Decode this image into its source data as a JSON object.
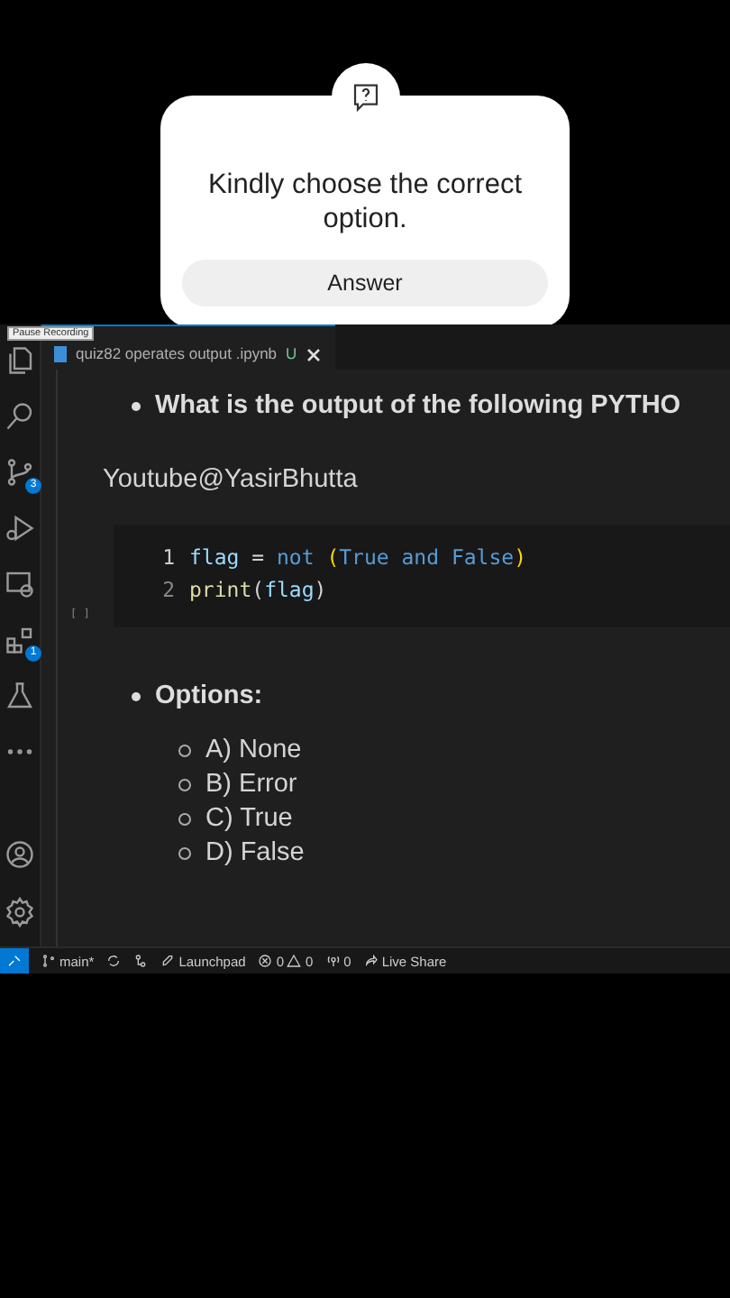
{
  "sticker": {
    "prompt": "Kindly choose the correct option.",
    "button": "Answer"
  },
  "tooltip": "Pause Recording",
  "tab": {
    "title": "quiz82 operates output .ipynb",
    "status": "U"
  },
  "activity_bar": {
    "source_control_badge": "3",
    "extensions_badge": "1"
  },
  "notebook": {
    "question": "What is the output of the following PYTHO",
    "credit": "Youtube@YasirBhutta",
    "cell_marker": "[ ]",
    "code": [
      {
        "number": "1",
        "tokens": [
          {
            "kind": "var",
            "text": "flag"
          },
          {
            "kind": "op",
            "text": " = "
          },
          {
            "kind": "keyword",
            "text": "not"
          },
          {
            "kind": "paren",
            "text": " ("
          },
          {
            "kind": "const",
            "text": "True"
          },
          {
            "kind": "keyword",
            "text": " and "
          },
          {
            "kind": "const",
            "text": "False"
          },
          {
            "kind": "paren",
            "text": ")"
          }
        ]
      },
      {
        "number": "2",
        "tokens": [
          {
            "kind": "func",
            "text": "print"
          },
          {
            "kind": "op",
            "text": "("
          },
          {
            "kind": "var",
            "text": "flag"
          },
          {
            "kind": "op",
            "text": ")"
          }
        ]
      }
    ],
    "options_heading": "Options:",
    "options": [
      "A) None",
      "B) Error",
      "C) True",
      "D) False"
    ]
  },
  "status_bar": {
    "branch": "main*",
    "launchpad": "Launchpad",
    "errors": "0",
    "warnings": "0",
    "ports": "0",
    "live_share": "Live Share"
  }
}
